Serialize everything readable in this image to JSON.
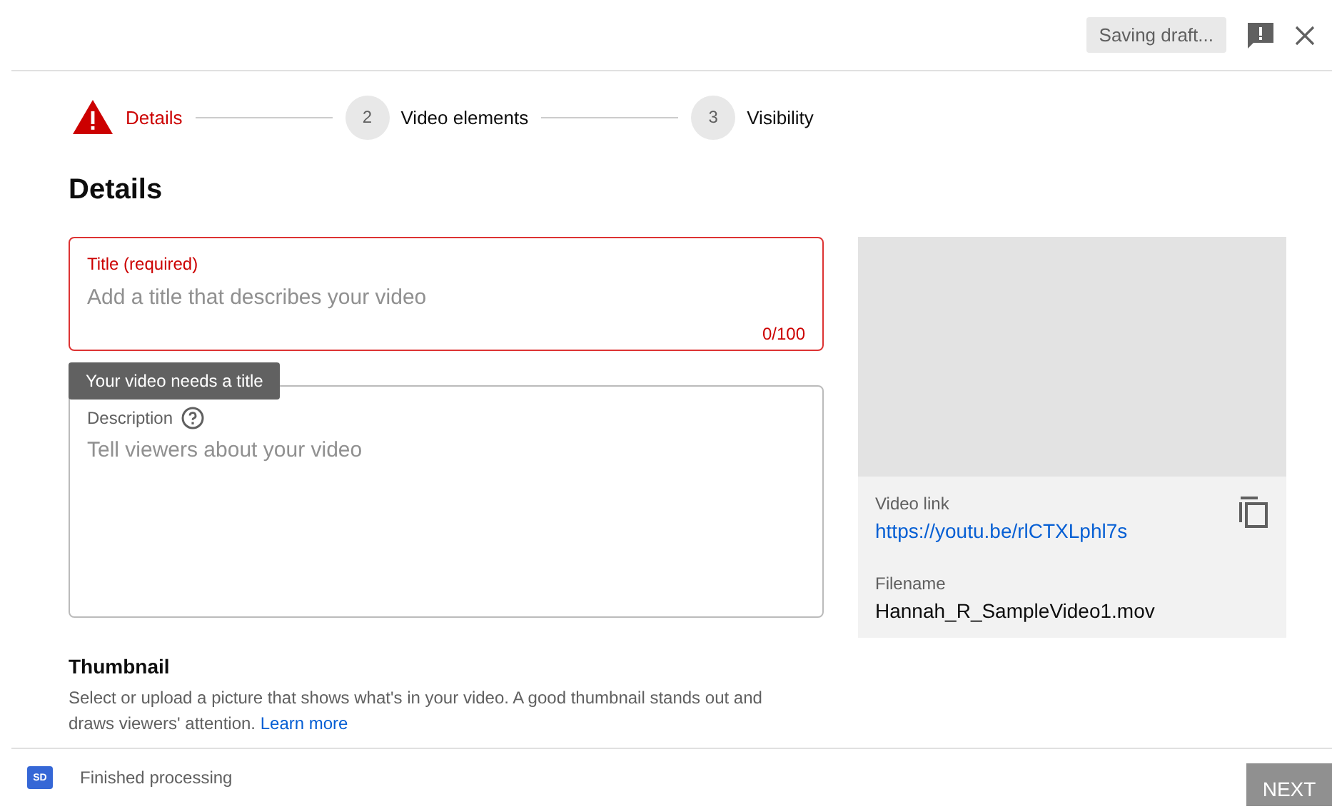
{
  "header": {
    "status": "Saving draft..."
  },
  "steps": [
    {
      "kind": "error",
      "label": "Details",
      "selected": true
    },
    {
      "kind": "number",
      "number": "2",
      "label": "Video elements",
      "selected": false
    },
    {
      "kind": "number",
      "number": "3",
      "label": "Visibility",
      "selected": false
    }
  ],
  "heading": "Details",
  "title_field": {
    "label": "Title (required)",
    "placeholder": "Add a title that describes your video",
    "counter": "0/100",
    "error": true
  },
  "tooltip": "Your video needs a title",
  "description_field": {
    "label": "Description",
    "placeholder": "Tell viewers about your video"
  },
  "preview": {
    "link_label": "Video link",
    "link": "https://youtu.be/rlCTXLphl7s",
    "filename_label": "Filename",
    "filename": "Hannah_R_SampleVideo1.mov"
  },
  "thumbnail": {
    "heading": "Thumbnail",
    "text": "Select or upload a picture that shows what's in your video. A good thumbnail stands out and draws viewers' attention.",
    "link": "Learn more"
  },
  "footer": {
    "badge": "SD",
    "status": "Finished processing",
    "next": "NEXT",
    "next_disabled": true
  }
}
